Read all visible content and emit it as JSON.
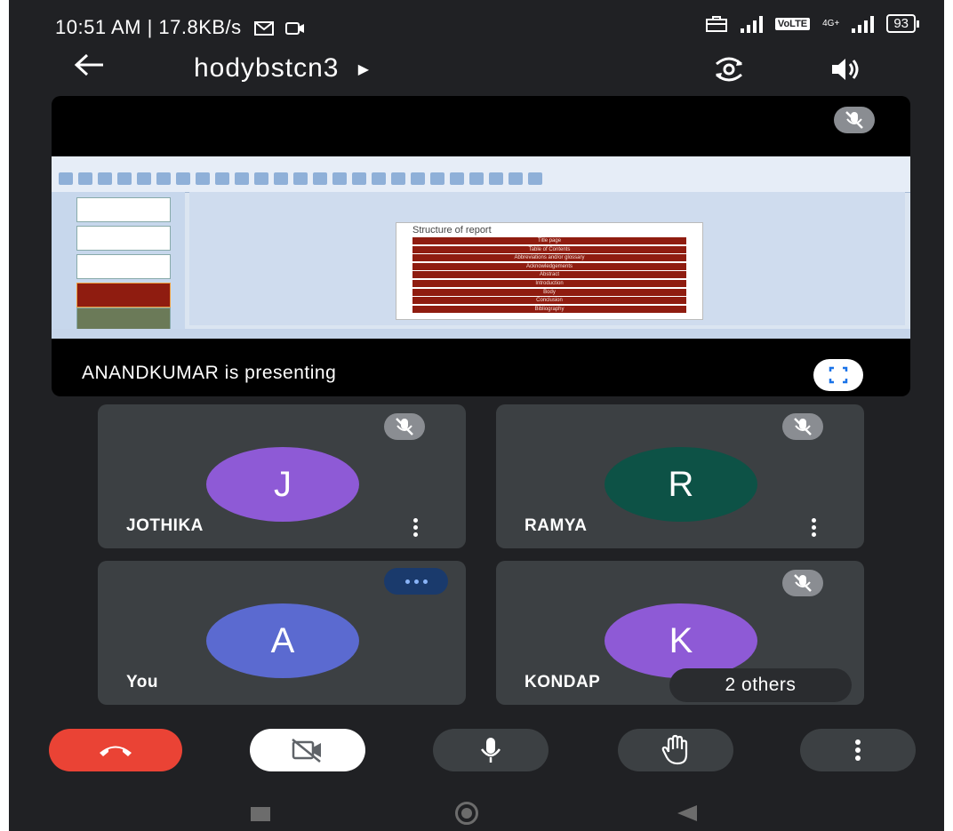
{
  "status_bar": {
    "time_speed": "10:51 AM | 17.8KB/s",
    "signal_tag": "4G+",
    "volte_badge": "VoLTE",
    "battery": "93"
  },
  "top_bar": {
    "meeting_code": "hodybstcn3"
  },
  "presentation": {
    "presenting_label": "ANANDKUMAR is presenting",
    "slide_title": "Structure of report",
    "slide_items": [
      "Title page",
      "Table of Contents",
      "Abbreviations and/or glossary",
      "Acknowledgements",
      "Abstract",
      "Introduction",
      "Body",
      "Conclusion",
      "Bibliography"
    ]
  },
  "participants": [
    {
      "name": "JOTHIKA",
      "initial": "J",
      "color": "#8e5ad6",
      "state": "muted"
    },
    {
      "name": "RAMYA",
      "initial": "R",
      "color": "#0d5246",
      "state": "muted"
    },
    {
      "name": "You",
      "initial": "A",
      "color": "#5b6ad0",
      "state": "typing"
    },
    {
      "name": "KONDAP",
      "initial": "K",
      "color": "#8e5ad6",
      "state": "muted"
    }
  ],
  "others_chip": "2 others",
  "controls": {
    "end_call_color": "#ea4335",
    "icons": [
      "end-call-icon",
      "camera-off-icon",
      "microphone-icon",
      "raise-hand-icon",
      "more-options-icon"
    ]
  },
  "colors": {
    "background": "#202124",
    "tile": "#3c4043",
    "mute_badge": "#8a8d92"
  }
}
